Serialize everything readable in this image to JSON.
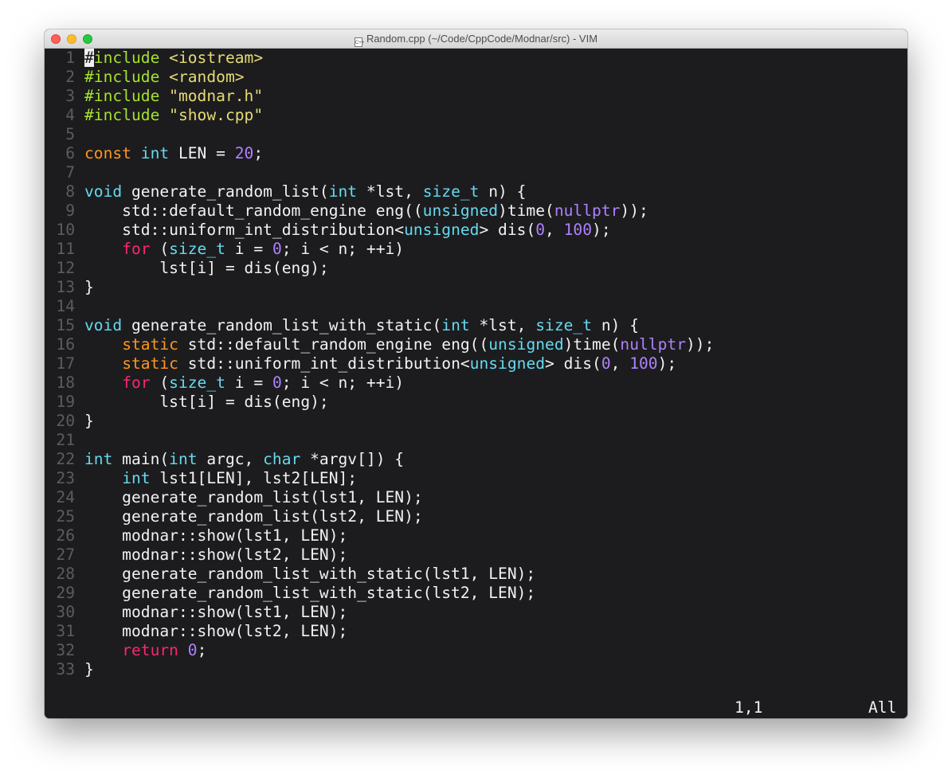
{
  "window": {
    "title": "Random.cpp (~/Code/CppCode/Modnar/src) - VIM",
    "file_icon_label": "C++"
  },
  "colors": {
    "background": "#1c1c1e",
    "line_number": "#5c5c5c",
    "text": "#f2f2f2",
    "preproc": "#a6e22e",
    "string": "#e6db74",
    "storage": "#fd971f",
    "type": "#66d9ef",
    "keyword": "#f92672",
    "number": "#ae81ff"
  },
  "editor": {
    "lines": [
      {
        "n": "1",
        "segments": [
          {
            "t": "#",
            "c": "cursor"
          },
          {
            "t": "include ",
            "c": "preproc"
          },
          {
            "t": "<iostream>",
            "c": "string"
          }
        ]
      },
      {
        "n": "2",
        "segments": [
          {
            "t": "#include ",
            "c": "preproc"
          },
          {
            "t": "<random>",
            "c": "string"
          }
        ]
      },
      {
        "n": "3",
        "segments": [
          {
            "t": "#include ",
            "c": "preproc"
          },
          {
            "t": "\"modnar.h\"",
            "c": "string"
          }
        ]
      },
      {
        "n": "4",
        "segments": [
          {
            "t": "#include ",
            "c": "preproc"
          },
          {
            "t": "\"show.cpp\"",
            "c": "string"
          }
        ]
      },
      {
        "n": "5",
        "segments": []
      },
      {
        "n": "6",
        "segments": [
          {
            "t": "const",
            "c": "storage"
          },
          {
            "t": " ",
            "c": "text"
          },
          {
            "t": "int",
            "c": "type"
          },
          {
            "t": " LEN = ",
            "c": "text"
          },
          {
            "t": "20",
            "c": "number"
          },
          {
            "t": ";",
            "c": "text"
          }
        ]
      },
      {
        "n": "7",
        "segments": []
      },
      {
        "n": "8",
        "segments": [
          {
            "t": "void",
            "c": "type"
          },
          {
            "t": " generate_random_list(",
            "c": "text"
          },
          {
            "t": "int",
            "c": "type"
          },
          {
            "t": " *lst, ",
            "c": "text"
          },
          {
            "t": "size_t",
            "c": "type"
          },
          {
            "t": " n) {",
            "c": "text"
          }
        ]
      },
      {
        "n": "9",
        "segments": [
          {
            "t": "    std::default_random_engine eng((",
            "c": "text"
          },
          {
            "t": "unsigned",
            "c": "type"
          },
          {
            "t": ")time(",
            "c": "text"
          },
          {
            "t": "nullptr",
            "c": "number"
          },
          {
            "t": "));",
            "c": "text"
          }
        ]
      },
      {
        "n": "10",
        "segments": [
          {
            "t": "    std::uniform_int_distribution<",
            "c": "text"
          },
          {
            "t": "unsigned",
            "c": "type"
          },
          {
            "t": "> dis(",
            "c": "text"
          },
          {
            "t": "0",
            "c": "number"
          },
          {
            "t": ", ",
            "c": "text"
          },
          {
            "t": "100",
            "c": "number"
          },
          {
            "t": ");",
            "c": "text"
          }
        ]
      },
      {
        "n": "11",
        "segments": [
          {
            "t": "    ",
            "c": "text"
          },
          {
            "t": "for",
            "c": "keyword"
          },
          {
            "t": " (",
            "c": "text"
          },
          {
            "t": "size_t",
            "c": "type"
          },
          {
            "t": " i = ",
            "c": "text"
          },
          {
            "t": "0",
            "c": "number"
          },
          {
            "t": "; i < n; ++i)",
            "c": "text"
          }
        ]
      },
      {
        "n": "12",
        "segments": [
          {
            "t": "        lst[i] = dis(eng);",
            "c": "text"
          }
        ]
      },
      {
        "n": "13",
        "segments": [
          {
            "t": "}",
            "c": "text"
          }
        ]
      },
      {
        "n": "14",
        "segments": []
      },
      {
        "n": "15",
        "segments": [
          {
            "t": "void",
            "c": "type"
          },
          {
            "t": " generate_random_list_with_static(",
            "c": "text"
          },
          {
            "t": "int",
            "c": "type"
          },
          {
            "t": " *lst, ",
            "c": "text"
          },
          {
            "t": "size_t",
            "c": "type"
          },
          {
            "t": " n) {",
            "c": "text"
          }
        ]
      },
      {
        "n": "16",
        "segments": [
          {
            "t": "    ",
            "c": "text"
          },
          {
            "t": "static",
            "c": "storage"
          },
          {
            "t": " std::default_random_engine eng((",
            "c": "text"
          },
          {
            "t": "unsigned",
            "c": "type"
          },
          {
            "t": ")time(",
            "c": "text"
          },
          {
            "t": "nullptr",
            "c": "number"
          },
          {
            "t": "));",
            "c": "text"
          }
        ]
      },
      {
        "n": "17",
        "segments": [
          {
            "t": "    ",
            "c": "text"
          },
          {
            "t": "static",
            "c": "storage"
          },
          {
            "t": " std::uniform_int_distribution<",
            "c": "text"
          },
          {
            "t": "unsigned",
            "c": "type"
          },
          {
            "t": "> dis(",
            "c": "text"
          },
          {
            "t": "0",
            "c": "number"
          },
          {
            "t": ", ",
            "c": "text"
          },
          {
            "t": "100",
            "c": "number"
          },
          {
            "t": ");",
            "c": "text"
          }
        ]
      },
      {
        "n": "18",
        "segments": [
          {
            "t": "    ",
            "c": "text"
          },
          {
            "t": "for",
            "c": "keyword"
          },
          {
            "t": " (",
            "c": "text"
          },
          {
            "t": "size_t",
            "c": "type"
          },
          {
            "t": " i = ",
            "c": "text"
          },
          {
            "t": "0",
            "c": "number"
          },
          {
            "t": "; i < n; ++i)",
            "c": "text"
          }
        ]
      },
      {
        "n": "19",
        "segments": [
          {
            "t": "        lst[i] = dis(eng);",
            "c": "text"
          }
        ]
      },
      {
        "n": "20",
        "segments": [
          {
            "t": "}",
            "c": "text"
          }
        ]
      },
      {
        "n": "21",
        "segments": []
      },
      {
        "n": "22",
        "segments": [
          {
            "t": "int",
            "c": "type"
          },
          {
            "t": " main(",
            "c": "text"
          },
          {
            "t": "int",
            "c": "type"
          },
          {
            "t": " argc, ",
            "c": "text"
          },
          {
            "t": "char",
            "c": "type"
          },
          {
            "t": " *argv[]) {",
            "c": "text"
          }
        ]
      },
      {
        "n": "23",
        "segments": [
          {
            "t": "    ",
            "c": "text"
          },
          {
            "t": "int",
            "c": "type"
          },
          {
            "t": " lst1[LEN], lst2[LEN];",
            "c": "text"
          }
        ]
      },
      {
        "n": "24",
        "segments": [
          {
            "t": "    generate_random_list(lst1, LEN);",
            "c": "text"
          }
        ]
      },
      {
        "n": "25",
        "segments": [
          {
            "t": "    generate_random_list(lst2, LEN);",
            "c": "text"
          }
        ]
      },
      {
        "n": "26",
        "segments": [
          {
            "t": "    modnar::show(lst1, LEN);",
            "c": "text"
          }
        ]
      },
      {
        "n": "27",
        "segments": [
          {
            "t": "    modnar::show(lst2, LEN);",
            "c": "text"
          }
        ]
      },
      {
        "n": "28",
        "segments": [
          {
            "t": "    generate_random_list_with_static(lst1, LEN);",
            "c": "text"
          }
        ]
      },
      {
        "n": "29",
        "segments": [
          {
            "t": "    generate_random_list_with_static(lst2, LEN);",
            "c": "text"
          }
        ]
      },
      {
        "n": "30",
        "segments": [
          {
            "t": "    modnar::show(lst1, LEN);",
            "c": "text"
          }
        ]
      },
      {
        "n": "31",
        "segments": [
          {
            "t": "    modnar::show(lst2, LEN);",
            "c": "text"
          }
        ]
      },
      {
        "n": "32",
        "segments": [
          {
            "t": "    ",
            "c": "text"
          },
          {
            "t": "return",
            "c": "keyword"
          },
          {
            "t": " ",
            "c": "text"
          },
          {
            "t": "0",
            "c": "number"
          },
          {
            "t": ";",
            "c": "text"
          }
        ]
      },
      {
        "n": "33",
        "segments": [
          {
            "t": "}",
            "c": "text"
          }
        ]
      }
    ]
  },
  "statusline": {
    "cursor_position": "1,1",
    "scroll_position": "All"
  }
}
